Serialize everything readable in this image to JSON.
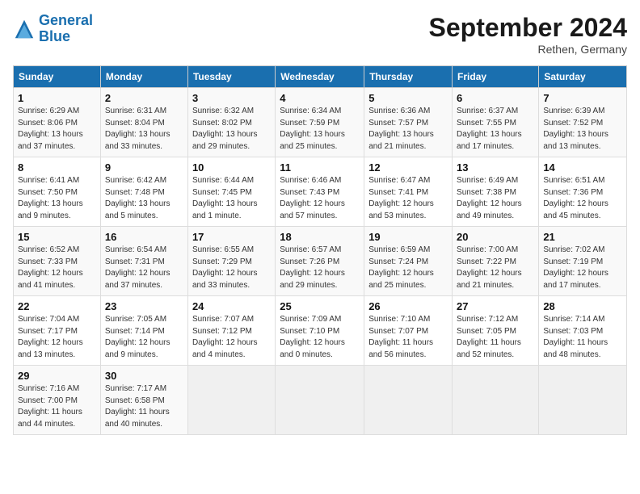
{
  "header": {
    "logo_line1": "General",
    "logo_line2": "Blue",
    "month_title": "September 2024",
    "subtitle": "Rethen, Germany"
  },
  "columns": [
    "Sunday",
    "Monday",
    "Tuesday",
    "Wednesday",
    "Thursday",
    "Friday",
    "Saturday"
  ],
  "weeks": [
    [
      {
        "day": "1",
        "detail": "Sunrise: 6:29 AM\nSunset: 8:06 PM\nDaylight: 13 hours\nand 37 minutes."
      },
      {
        "day": "2",
        "detail": "Sunrise: 6:31 AM\nSunset: 8:04 PM\nDaylight: 13 hours\nand 33 minutes."
      },
      {
        "day": "3",
        "detail": "Sunrise: 6:32 AM\nSunset: 8:02 PM\nDaylight: 13 hours\nand 29 minutes."
      },
      {
        "day": "4",
        "detail": "Sunrise: 6:34 AM\nSunset: 7:59 PM\nDaylight: 13 hours\nand 25 minutes."
      },
      {
        "day": "5",
        "detail": "Sunrise: 6:36 AM\nSunset: 7:57 PM\nDaylight: 13 hours\nand 21 minutes."
      },
      {
        "day": "6",
        "detail": "Sunrise: 6:37 AM\nSunset: 7:55 PM\nDaylight: 13 hours\nand 17 minutes."
      },
      {
        "day": "7",
        "detail": "Sunrise: 6:39 AM\nSunset: 7:52 PM\nDaylight: 13 hours\nand 13 minutes."
      }
    ],
    [
      {
        "day": "8",
        "detail": "Sunrise: 6:41 AM\nSunset: 7:50 PM\nDaylight: 13 hours\nand 9 minutes."
      },
      {
        "day": "9",
        "detail": "Sunrise: 6:42 AM\nSunset: 7:48 PM\nDaylight: 13 hours\nand 5 minutes."
      },
      {
        "day": "10",
        "detail": "Sunrise: 6:44 AM\nSunset: 7:45 PM\nDaylight: 13 hours\nand 1 minute."
      },
      {
        "day": "11",
        "detail": "Sunrise: 6:46 AM\nSunset: 7:43 PM\nDaylight: 12 hours\nand 57 minutes."
      },
      {
        "day": "12",
        "detail": "Sunrise: 6:47 AM\nSunset: 7:41 PM\nDaylight: 12 hours\nand 53 minutes."
      },
      {
        "day": "13",
        "detail": "Sunrise: 6:49 AM\nSunset: 7:38 PM\nDaylight: 12 hours\nand 49 minutes."
      },
      {
        "day": "14",
        "detail": "Sunrise: 6:51 AM\nSunset: 7:36 PM\nDaylight: 12 hours\nand 45 minutes."
      }
    ],
    [
      {
        "day": "15",
        "detail": "Sunrise: 6:52 AM\nSunset: 7:33 PM\nDaylight: 12 hours\nand 41 minutes."
      },
      {
        "day": "16",
        "detail": "Sunrise: 6:54 AM\nSunset: 7:31 PM\nDaylight: 12 hours\nand 37 minutes."
      },
      {
        "day": "17",
        "detail": "Sunrise: 6:55 AM\nSunset: 7:29 PM\nDaylight: 12 hours\nand 33 minutes."
      },
      {
        "day": "18",
        "detail": "Sunrise: 6:57 AM\nSunset: 7:26 PM\nDaylight: 12 hours\nand 29 minutes."
      },
      {
        "day": "19",
        "detail": "Sunrise: 6:59 AM\nSunset: 7:24 PM\nDaylight: 12 hours\nand 25 minutes."
      },
      {
        "day": "20",
        "detail": "Sunrise: 7:00 AM\nSunset: 7:22 PM\nDaylight: 12 hours\nand 21 minutes."
      },
      {
        "day": "21",
        "detail": "Sunrise: 7:02 AM\nSunset: 7:19 PM\nDaylight: 12 hours\nand 17 minutes."
      }
    ],
    [
      {
        "day": "22",
        "detail": "Sunrise: 7:04 AM\nSunset: 7:17 PM\nDaylight: 12 hours\nand 13 minutes."
      },
      {
        "day": "23",
        "detail": "Sunrise: 7:05 AM\nSunset: 7:14 PM\nDaylight: 12 hours\nand 9 minutes."
      },
      {
        "day": "24",
        "detail": "Sunrise: 7:07 AM\nSunset: 7:12 PM\nDaylight: 12 hours\nand 4 minutes."
      },
      {
        "day": "25",
        "detail": "Sunrise: 7:09 AM\nSunset: 7:10 PM\nDaylight: 12 hours\nand 0 minutes."
      },
      {
        "day": "26",
        "detail": "Sunrise: 7:10 AM\nSunset: 7:07 PM\nDaylight: 11 hours\nand 56 minutes."
      },
      {
        "day": "27",
        "detail": "Sunrise: 7:12 AM\nSunset: 7:05 PM\nDaylight: 11 hours\nand 52 minutes."
      },
      {
        "day": "28",
        "detail": "Sunrise: 7:14 AM\nSunset: 7:03 PM\nDaylight: 11 hours\nand 48 minutes."
      }
    ],
    [
      {
        "day": "29",
        "detail": "Sunrise: 7:16 AM\nSunset: 7:00 PM\nDaylight: 11 hours\nand 44 minutes."
      },
      {
        "day": "30",
        "detail": "Sunrise: 7:17 AM\nSunset: 6:58 PM\nDaylight: 11 hours\nand 40 minutes."
      },
      {
        "day": "",
        "detail": ""
      },
      {
        "day": "",
        "detail": ""
      },
      {
        "day": "",
        "detail": ""
      },
      {
        "day": "",
        "detail": ""
      },
      {
        "day": "",
        "detail": ""
      }
    ]
  ]
}
